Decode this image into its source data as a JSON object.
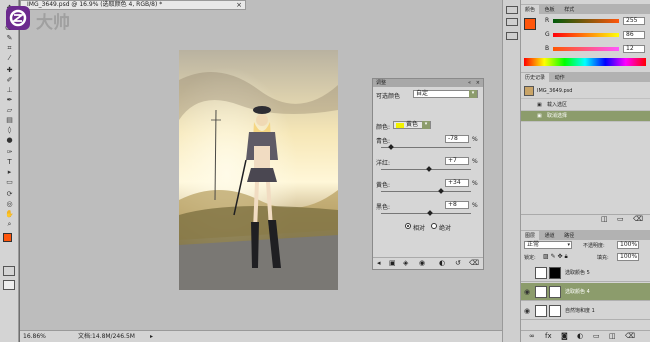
{
  "document": {
    "tab_title": "IMG_3649.psd @ 16.9% (选取颜色 4, RGB/8) *",
    "close": "×"
  },
  "watermark": {
    "text": "大帅"
  },
  "status": {
    "zoom": "16.86%",
    "doc_info": "文档:14.8M/246.5M"
  },
  "adjustments": {
    "panel_title": "调整",
    "preset_label": "可选颜色",
    "preset_value": "自定",
    "colors_label": "颜色:",
    "colors_value": "黄色",
    "sliders": [
      {
        "label": "青色:",
        "value": "-78",
        "unit": "%",
        "level": -78
      },
      {
        "label": "洋红:",
        "value": "+7",
        "unit": "%",
        "level": 7
      },
      {
        "label": "黄色:",
        "value": "+34",
        "unit": "%",
        "level": 34
      },
      {
        "label": "黑色:",
        "value": "+8",
        "unit": "%",
        "level": 8
      }
    ],
    "method_relative": "相对",
    "method_absolute": "绝对"
  },
  "color_panel": {
    "tabs": [
      "颜色",
      "色板",
      "样式"
    ],
    "channels": [
      {
        "label": "R",
        "value": "255",
        "level": 255
      },
      {
        "label": "G",
        "value": "86",
        "level": 86
      },
      {
        "label": "B",
        "value": "12",
        "level": 12
      }
    ],
    "foreground": "#ff560c"
  },
  "history_panel": {
    "tabs": [
      "历史记录",
      "动作"
    ],
    "snapshot": "IMG_3649.psd",
    "items": [
      "载入选区",
      "取消选择"
    ]
  },
  "layers_panel": {
    "tabs": [
      "图层",
      "通道",
      "路径"
    ],
    "blend_mode": "正常",
    "opacity_label": "不透明度:",
    "opacity_value": "100%",
    "lock_label": "锁定:",
    "fill_label": "填充:",
    "fill_value": "100%",
    "layers": [
      {
        "name": "选取颜色 5",
        "selected": false
      },
      {
        "name": "选取颜色 4",
        "selected": true
      },
      {
        "name": "自然饱和度 1",
        "selected": false
      }
    ]
  },
  "colors": {
    "accent_selected": "#8c9c6c",
    "foreground": "#ff560c"
  }
}
